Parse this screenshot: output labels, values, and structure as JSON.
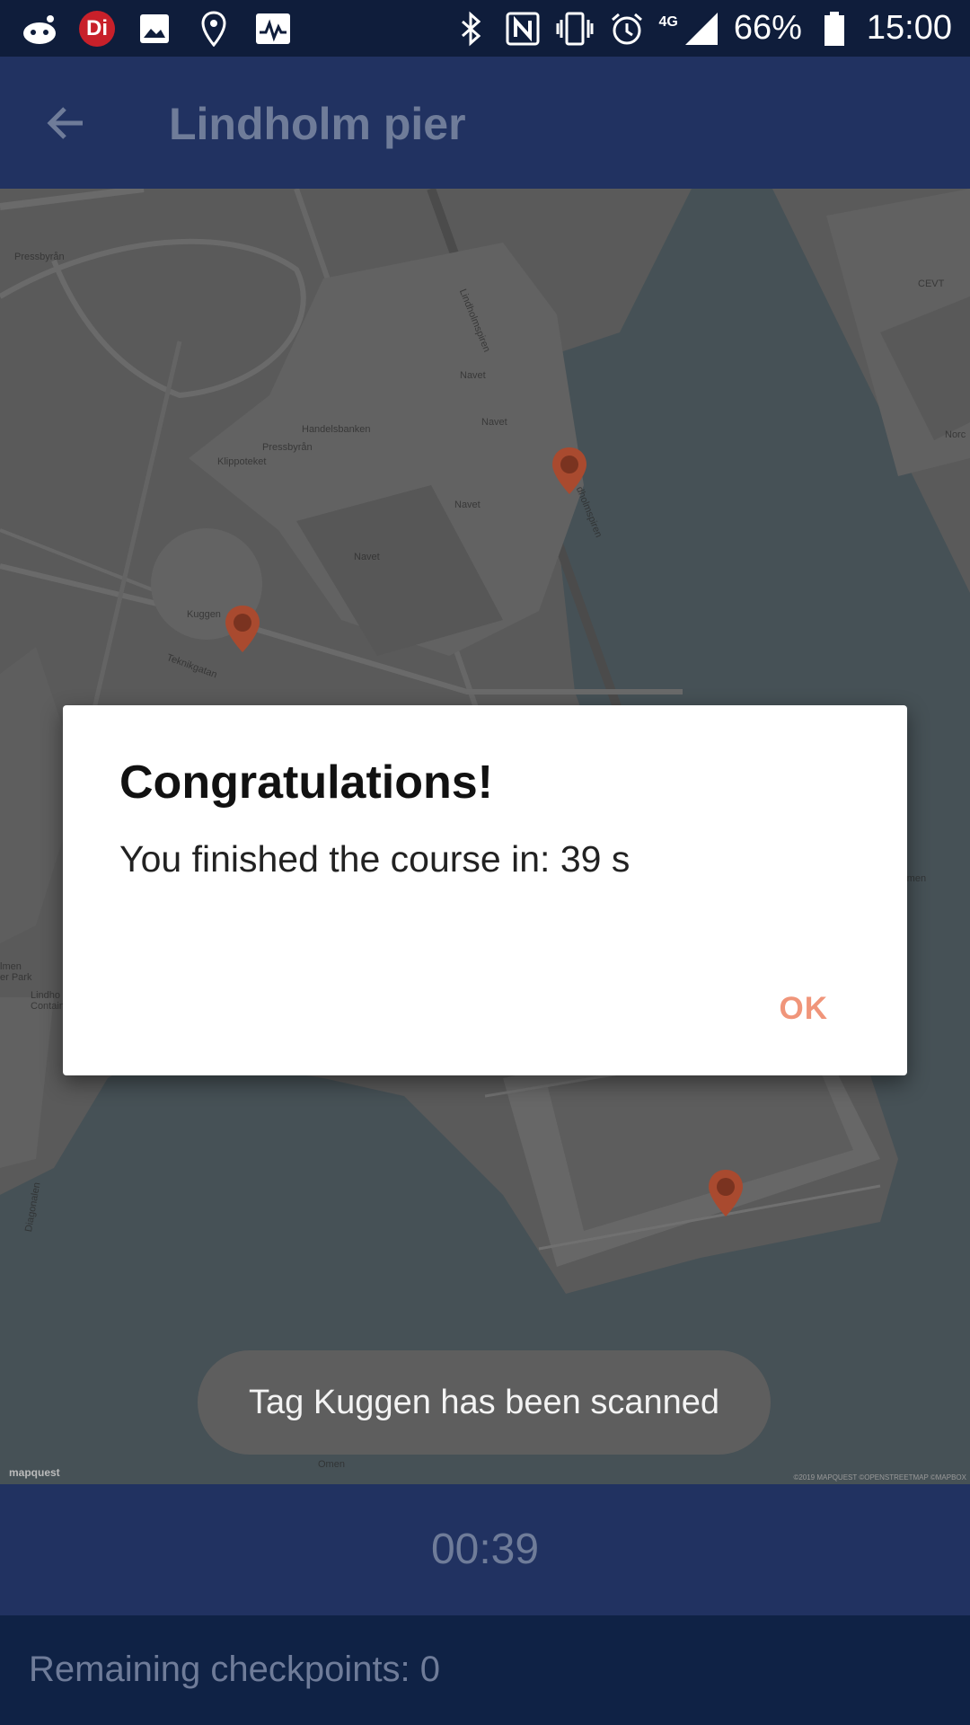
{
  "status_bar": {
    "icons_left": [
      "reddit-icon",
      "di-icon",
      "image-icon",
      "location-pin-icon",
      "activity-icon"
    ],
    "di_label": "Di",
    "icons_right": [
      "bluetooth-icon",
      "nfc-icon",
      "vibrate-icon",
      "alarm-icon",
      "network-4g-icon",
      "signal-icon",
      "battery-icon"
    ],
    "network": "4G",
    "battery": "66%",
    "time": "15:00"
  },
  "app_bar": {
    "title": "Lindholm pier",
    "back_icon": "arrow-left-icon"
  },
  "map": {
    "labels": {
      "pressbyran_1": "Pressbyrån",
      "lindholmspiren_1": "Lindholmspiren",
      "navet_1": "Navet",
      "navet_2": "Navet",
      "handelsbanken": "Handelsbanken",
      "pressbyran_2": "Pressbyrån",
      "klippoteket": "Klippoteket",
      "navet_3": "Navet",
      "navet_4": "Navet",
      "lindholmspiren_2": "dholmspiren",
      "kuggen": "Kuggen",
      "teknikgatan": "Teknikgatan",
      "cevt": "CEVT",
      "norc": "Norc",
      "almen_park": "lmen\ner Park",
      "lindh_contain": "Lindho\nContain",
      "diagonalen": "Diagonalen",
      "omen": "Omen",
      "armen": "rmen"
    },
    "attribution_left": "mapquest",
    "attribution_right": "©2019 MAPQUEST ©OPENSTREETMAP ©MAPBOX"
  },
  "dialog": {
    "title": "Congratulations!",
    "message": "You finished the course in: 39 s",
    "ok_label": "OK"
  },
  "toast": {
    "message": "Tag Kuggen has been scanned"
  },
  "timer": {
    "value": "00:39"
  },
  "footer": {
    "remaining": "Remaining checkpoints: 0"
  },
  "colors": {
    "status_bar": "#0f1d3b",
    "app_bar": "#213261",
    "footer": "#0f2245",
    "accent_ok": "#f0957a",
    "marker": "#a94a2f"
  }
}
